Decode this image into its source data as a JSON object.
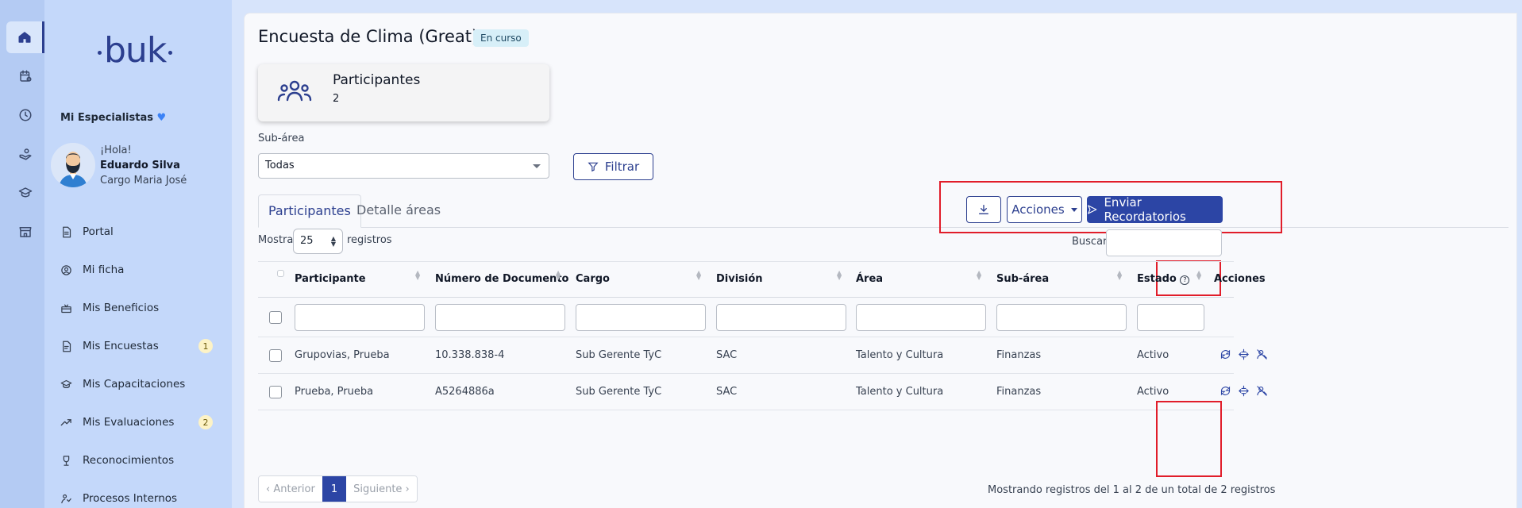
{
  "rail": {
    "icons": [
      "home-icon",
      "calendar-icon",
      "clock-icon",
      "benefits-icon",
      "graduation-icon",
      "store-icon"
    ]
  },
  "sidebar": {
    "logo": "buk",
    "team": "Mi Especialistas",
    "greeting": "¡Hola!",
    "user_name": "Eduardo Silva",
    "user_role": "Cargo Maria José",
    "items": [
      {
        "label": "Portal",
        "icon": "document-icon"
      },
      {
        "label": "Mi ficha",
        "icon": "user-circle-icon"
      },
      {
        "label": "Mis Beneficios",
        "icon": "gift-icon"
      },
      {
        "label": "Mis Encuestas",
        "icon": "survey-icon",
        "badge": "1"
      },
      {
        "label": "Mis Capacitaciones",
        "icon": "graduation-icon"
      },
      {
        "label": "Mis Evaluaciones",
        "icon": "trend-icon",
        "badge": "2"
      },
      {
        "label": "Reconocimientos",
        "icon": "trophy-icon"
      },
      {
        "label": "Procesos Internos",
        "icon": "process-icon"
      }
    ]
  },
  "header": {
    "title": "Encuesta de Clima (Great)",
    "status": "En curso"
  },
  "summary": {
    "title": "Participantes",
    "count": "2"
  },
  "filters": {
    "subarea_label": "Sub-área",
    "subarea_value": "Todas",
    "filter_button": "Filtrar"
  },
  "tabs": [
    "Participantes",
    "Detalle áreas"
  ],
  "toolbar": {
    "actions_label": "Acciones",
    "send_label": "Enviar Recordatorios"
  },
  "table_controls": {
    "show_label": "Mostrar",
    "page_length": "25",
    "records_label": "registros",
    "search_label": "Buscar:"
  },
  "table": {
    "columns": [
      "Participante",
      "Número de Documento",
      "Cargo",
      "División",
      "Área",
      "Sub-área",
      "Estado",
      "Acciones"
    ],
    "rows": [
      [
        "Grupovias, Prueba",
        "10.338.838-4",
        "Sub Gerente TyC",
        "SAC",
        "Talento y Cultura",
        "Finanzas",
        "Activo"
      ],
      [
        "Prueba, Prueba",
        "A5264886a",
        "Sub Gerente TyC",
        "SAC",
        "Talento y Cultura",
        "Finanzas",
        "Activo"
      ]
    ],
    "row_action_icons": [
      "sync-icon",
      "reassign-icon",
      "disable-notifications-icon"
    ]
  },
  "pagination": {
    "prev": "Anterior",
    "current": "1",
    "next": "Siguiente",
    "info": "Mostrando registros del 1 al 2 de un total de 2 registros"
  },
  "colors": {
    "primary": "#2c45a5",
    "highlight": "#e11d2a",
    "sidebar_bg": "#c4d8fa",
    "rail_bg": "#b4cbf3"
  }
}
